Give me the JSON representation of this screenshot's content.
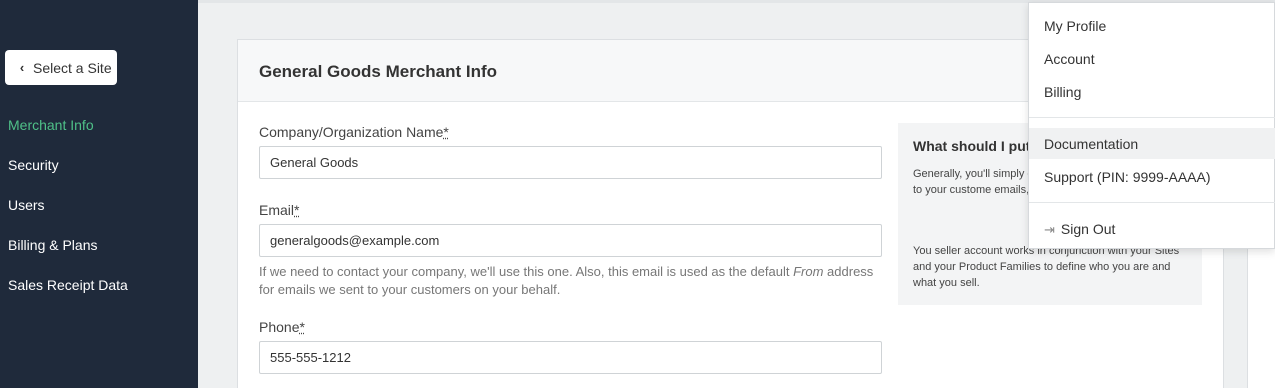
{
  "sidebar": {
    "select_site": "Select a Site",
    "items": [
      {
        "label": "Merchant Info"
      },
      {
        "label": "Security"
      },
      {
        "label": "Users"
      },
      {
        "label": "Billing & Plans"
      },
      {
        "label": "Sales Receipt Data"
      }
    ]
  },
  "card": {
    "title": "General Goods Merchant Info",
    "company_label": "Company/Organization Name",
    "company_value": "General Goods",
    "email_label": "Email",
    "email_value": "generalgoods@example.com",
    "help_text_1": "If we need to contact your company, we'll use this one. Also, this email is used as the default ",
    "help_text_em": "From",
    "help_text_2": " address for emails we sent to your customers on your behalf.",
    "phone_label": "Phone",
    "phone_value": "555-555-1212",
    "required_mark": "*"
  },
  "info": {
    "title": "What should I put",
    "p1": "Generally, you'll simply customers call you. You emails to your custome emails, etc.)",
    "p2": "You seller account works in conjunction with your Sites and your Product Families to define who you are and what you sell."
  },
  "dropdown": {
    "items": [
      "My Profile",
      "Account",
      "Billing",
      "Documentation",
      "Support (PIN: 9999-AAAA)"
    ],
    "sign_out": "Sign Out"
  },
  "colors": {
    "sidebar_bg": "#1f2a3b",
    "active_nav": "#4fc088"
  }
}
